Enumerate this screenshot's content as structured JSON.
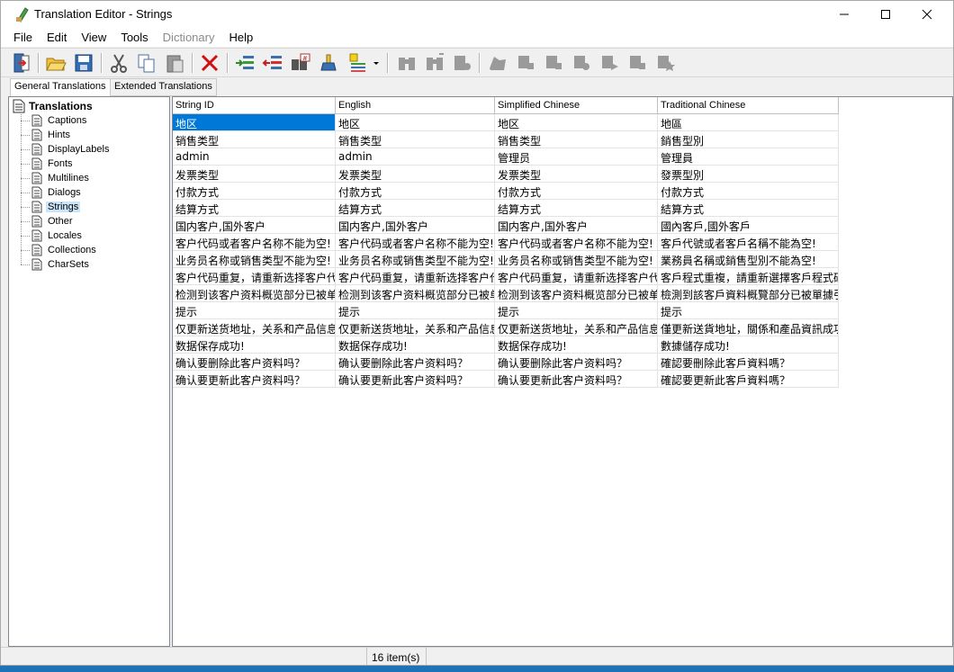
{
  "window": {
    "title": "Translation Editor - Strings",
    "minimize_icon": "minimize-icon",
    "maximize_icon": "maximize-icon",
    "close_icon": "close-icon"
  },
  "menu": [
    "File",
    "Edit",
    "View",
    "Tools",
    "Dictionary",
    "Help"
  ],
  "menu_disabled": [
    "Dictionary"
  ],
  "toolbar": {
    "icons": [
      "exit-icon",
      "open-folder-icon",
      "save-icon",
      "cut-icon",
      "copy-icon",
      "paste-icon",
      "delete-icon",
      "add-row-icon",
      "remove-row-icon",
      "translate-icon",
      "paint-icon",
      "list-icon",
      "dropdown-icon",
      "find-icon",
      "find-next-icon",
      "replace-icon",
      "tool-1-icon",
      "tool-2-icon",
      "tool-3-icon",
      "tool-4-icon",
      "tool-5-icon",
      "tool-6-icon",
      "tool-7-icon"
    ]
  },
  "tabs": {
    "general": "General Translations",
    "extended": "Extended Translations",
    "active": "general"
  },
  "tree": {
    "root": "Translations",
    "items": [
      "Captions",
      "Hints",
      "DisplayLabels",
      "Fonts",
      "Multilines",
      "Dialogs",
      "Strings",
      "Other",
      "Locales",
      "Collections",
      "CharSets"
    ],
    "selected": "Strings"
  },
  "grid": {
    "columns": [
      "String ID",
      "English",
      "Simplified Chinese",
      "Traditional Chinese"
    ],
    "rows": [
      [
        "地区",
        "地区",
        "地区",
        "地區"
      ],
      [
        "销售类型",
        "销售类型",
        "销售类型",
        "銷售型別"
      ],
      [
        "admin",
        "admin",
        "管理员",
        "管理員"
      ],
      [
        "发票类型",
        "发票类型",
        "发票类型",
        "發票型別"
      ],
      [
        "付款方式",
        "付款方式",
        "付款方式",
        "付款方式"
      ],
      [
        "结算方式",
        "结算方式",
        "结算方式",
        "結算方式"
      ],
      [
        "国内客户,国外客户",
        "国内客户,国外客户",
        "国内客户,国外客户",
        "國內客戶,國外客戶"
      ],
      [
        "客户代码或者客户名称不能为空!",
        "客户代码或者客户名称不能为空!",
        "客户代码或者客户名称不能为空!",
        "客戶代號或者客戶名稱不能為空!"
      ],
      [
        "业务员名称或销售类型不能为空!",
        "业务员名称或销售类型不能为空!",
        "业务员名称或销售类型不能为空!",
        "業務員名稱或銷售型別不能為空!"
      ],
      [
        "客户代码重复，请重新选择客户代",
        "客户代码重复，请重新选择客户代",
        "客户代码重复，请重新选择客户代",
        "客戶程式重複，請重新選擇客戶程式碼"
      ],
      [
        "检测到该客户资料概览部分已被单",
        "检测到该客户资料概览部分已被单",
        "检测到该客户资料概览部分已被单",
        "檢測到該客戶資料概覽部分已被單據引"
      ],
      [
        "提示",
        "提示",
        "提示",
        "提示"
      ],
      [
        "仅更新送货地址，关系和产品信息",
        "仅更新送货地址，关系和产品信息",
        "仅更新送货地址，关系和产品信息",
        "僅更新送貨地址，關係和產品資訊成功"
      ],
      [
        "数据保存成功!",
        "数据保存成功!",
        "数据保存成功!",
        "數據儲存成功!"
      ],
      [
        "确认要删除此客户资料吗？",
        "确认要删除此客户资料吗？",
        "确认要删除此客户资料吗？",
        "確認要刪除此客戶資料嗎？"
      ],
      [
        "确认要更新此客户资料吗？",
        "确认要更新此客户资料吗？",
        "确认要更新此客户资料吗？",
        "確認要更新此客戶資料嗎？"
      ]
    ],
    "selected_cell": [
      0,
      0
    ]
  },
  "status": {
    "count": "16 item(s)"
  }
}
